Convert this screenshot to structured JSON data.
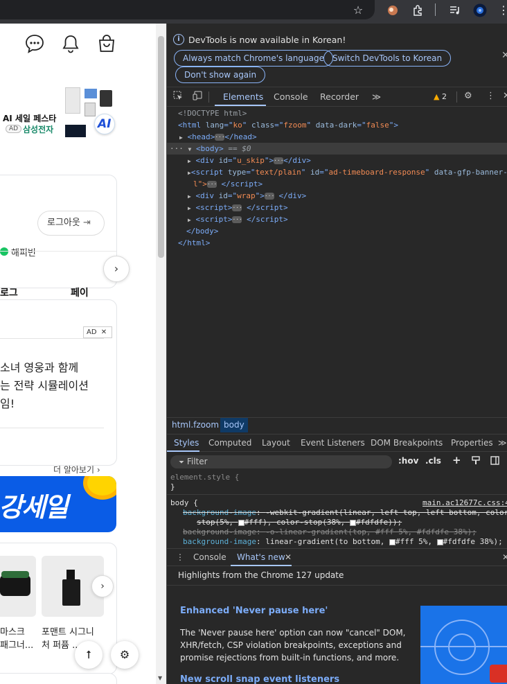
{
  "browser": {
    "icons": [
      "star-icon",
      "extension-avatar-icon",
      "puzzle-icon",
      "media-icon",
      "profile-icon",
      "more-icon"
    ]
  },
  "page": {
    "header_icons": [
      "chat-icon",
      "bell-icon",
      "shopping-bag-icon"
    ],
    "promo": {
      "title": "AI 세일 페스타",
      "ad_badge": "AD",
      "brand": "삼성전자",
      "ai_badge": "AI"
    },
    "login": {
      "logout_label": "로그아웃",
      "logout_icon": "⇥",
      "points_label": "해피빈",
      "tab_blog": "로그",
      "tab_pay": "페이"
    },
    "ad_card": {
      "badge": "AD",
      "close": "✕",
      "lines": [
        "소녀 영웅과 함께",
        "는 전략 시뮬레이션",
        "임!"
      ],
      "more_label": "더 알아보기",
      "more_icon": "›"
    },
    "banner": {
      "text": "강세일"
    },
    "products": [
      {
        "line1": "마스크",
        "line2": "패그너..."
      },
      {
        "line1": "포맨트 시그니",
        "line2": "처 퍼퓸 ..."
      }
    ],
    "floating": {
      "top_icon": "⭡",
      "settings_icon": "⚙"
    }
  },
  "devtools": {
    "infobar": {
      "message": "DevTools is now available in Korean!",
      "btn_match": "Always match Chrome's language",
      "btn_switch": "Switch DevTools to Korean",
      "btn_dont": "Don't show again",
      "close": "✕"
    },
    "tabs": {
      "elements": "Elements",
      "console": "Console",
      "recorder": "Recorder",
      "more": "≫",
      "warning_count": "2"
    },
    "dom": {
      "doctype": "<!DOCTYPE html>",
      "html_lang": "ko",
      "html_class": "fzoom",
      "html_dark": "false",
      "head": "head",
      "body_eq": "== $0",
      "div1_id": "u_skip",
      "script_type": "text/plain",
      "script_id": "ad-timeboard-response",
      "script_attr": "data-gfp-banner-type=\"f",
      "script_cont": "l\">",
      "div2_id": "wrap"
    },
    "breadcrumbs": [
      "html.fzoom",
      "body"
    ],
    "sub_tabs": [
      "Styles",
      "Computed",
      "Layout",
      "Event Listeners",
      "DOM Breakpoints",
      "Properties",
      "≫"
    ],
    "filter": {
      "placeholder": "Filter",
      "hov": ":hov",
      "cls": ".cls",
      "plus": "+"
    },
    "styles": {
      "element_style": "element.style {",
      "close_brace": "}",
      "body_sel": "body {",
      "source": "main.ac12677c.css:41",
      "r1_prop": "background-image",
      "r1_val": "-webkit-gradient(linear, left top, left bottom, color-",
      "r1_val2a": "stop(5%,",
      "r1_val2b": "#fff), color-stop(38%,",
      "r1_val2c": "#fdfdfe));",
      "r2_prop": "background-image",
      "r2_val": "-o-linear-gradient(top, #fff 5%, #fdfdfe 38%);",
      "r3_prop": "background-image",
      "r3_val_a": "linear-gradient(to bottom,",
      "r3_val_b": "#fff 5%,",
      "r3_val_c": "#fdfdfe 38%);"
    },
    "drawer": {
      "console": "Console",
      "whats_new": "What's new",
      "close": "✕",
      "highlights": "Highlights from the Chrome 127 update",
      "h1": "Enhanced 'Never pause here'",
      "p1": [
        "The 'Never pause here' option can now \"cancel\" DOM,",
        "XHR/fetch, CSP violation breakpoints, exceptions and",
        "promise rejections from built-in functions, and more."
      ],
      "h2": "New scroll snap event listeners"
    },
    "colors": {
      "accent": "#a8c7fa",
      "tag": "#7cacf8",
      "attr_value": "#f28b54",
      "warning": "#f9ab00"
    }
  }
}
